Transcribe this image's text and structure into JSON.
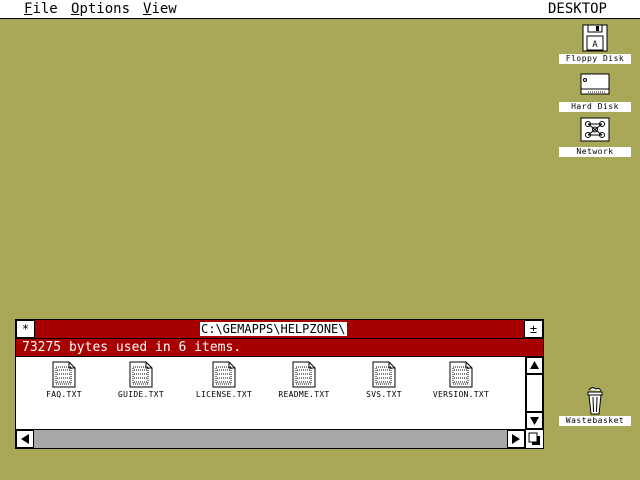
{
  "menubar": {
    "items": [
      {
        "label": "File",
        "key": "F",
        "rest": "ile"
      },
      {
        "label": "Options",
        "key": "O",
        "rest": "ptions"
      },
      {
        "label": "View",
        "key": "V",
        "rest": "iew"
      }
    ],
    "desktop_label": "DESKTOP"
  },
  "desktop_icons": {
    "floppy": {
      "label": "Floppy Disk",
      "icon": "floppy-disk-icon"
    },
    "hard": {
      "label": "Hard Disk",
      "icon": "hard-disk-icon"
    },
    "network": {
      "label": "Network",
      "icon": "network-icon"
    },
    "trash": {
      "label": "Wastebasket",
      "icon": "wastebasket-icon"
    }
  },
  "window": {
    "title": "C:\\GEMAPPS\\HELPZONE\\",
    "close_symbol": "*",
    "fuller_symbol": "±",
    "info": "73275 bytes used in 6 items.",
    "files": [
      {
        "name": "FAQ.TXT"
      },
      {
        "name": "GUIDE.TXT"
      },
      {
        "name": "LICENSE.TXT"
      },
      {
        "name": "README.TXT"
      },
      {
        "name": "SVS.TXT"
      },
      {
        "name": "VERSION.TXT"
      }
    ]
  },
  "colors": {
    "desktop": "#a8a858",
    "titlebar": "#a80000",
    "scroll_track": "#a8a8a8"
  }
}
